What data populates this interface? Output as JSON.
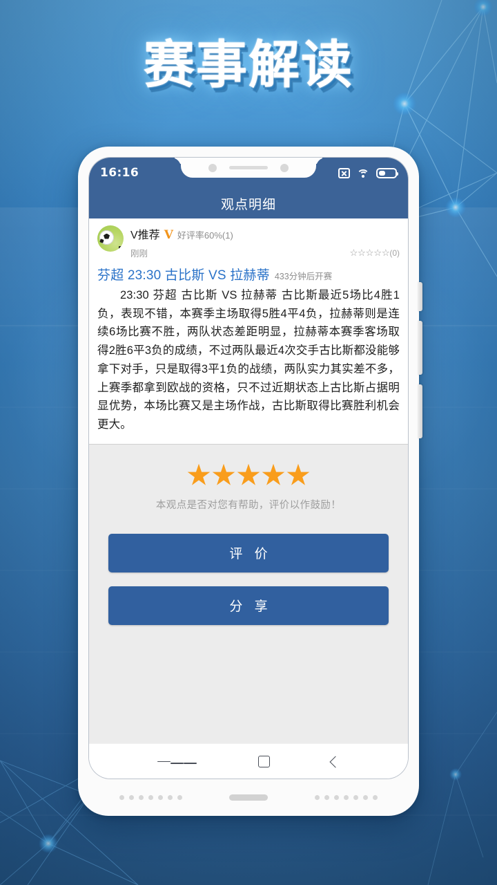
{
  "banner": {
    "title": "赛事解读"
  },
  "phone": {
    "statusbar": {
      "clock": "16:16",
      "icons": [
        "no-signal-icon",
        "wifi-icon",
        "battery-icon"
      ]
    },
    "appbar": {
      "title": "观点明细"
    },
    "post": {
      "avatar": "soccer-ball-avatar",
      "author": "V推荐",
      "verified_badge": "V",
      "praise_rate": "好评率60%(1)",
      "time": "刚刚",
      "rating_stars": "☆☆☆☆☆",
      "rating_count": "(0)",
      "match_title": "芬超 23:30 古比斯 VS 拉赫蒂",
      "kickoff": "433分钟后开赛",
      "body": "23:30 芬超 古比斯 VS 拉赫蒂 古比斯最近5场比4胜1负，表现不错，本赛季主场取得5胜4平4负，拉赫蒂则是连续6场比赛不胜，两队状态差距明显，拉赫蒂本赛季客场取得2胜6平3负的成绩，不过两队最近4次交手古比斯都没能够拿下对手，只是取得3平1负的战绩，两队实力其实差不多，上赛季都拿到欧战的资格，只不过近期状态上古比斯占据明显优势，本场比赛又是主场作战，古比斯取得比赛胜利机会更大。"
    },
    "rating": {
      "stars_filled": 5,
      "hint": "本观点是否对您有帮助，评价以作鼓励！"
    },
    "actions": {
      "rate_label": "评 价",
      "share_label": "分 享"
    },
    "navbar": {
      "menu": "menu-icon",
      "home": "home-square-icon",
      "back": "back-chevron-icon"
    }
  },
  "colors": {
    "brand_blue": "#3c6397",
    "button_blue": "#31609f",
    "link_blue": "#2a72c8",
    "star_orange": "#f99d1c",
    "badge_orange": "#f2941b",
    "bg_gray": "#ececec"
  }
}
